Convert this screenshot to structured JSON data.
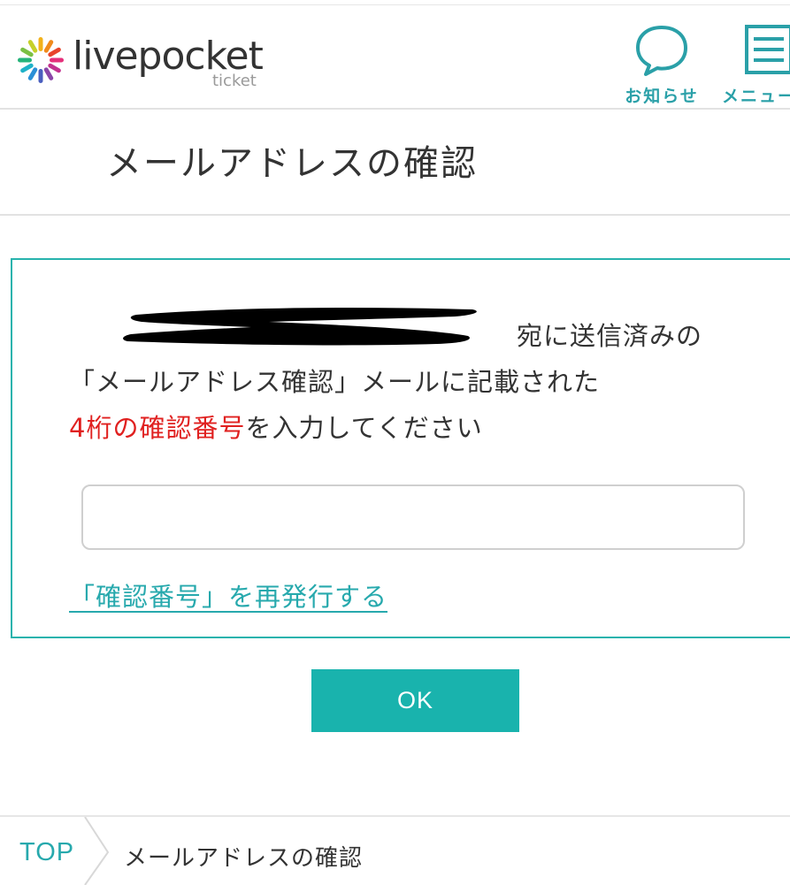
{
  "header": {
    "logo_text": "livepocket",
    "logo_sub": "ticket",
    "news_label": "お知らせ",
    "menu_label": "メニュー",
    "accent_color": "#2aa0a8"
  },
  "page": {
    "title": "メールアドレスの確認"
  },
  "form": {
    "instruction_line1": "宛に送信済みの",
    "instruction_line2": "「メールアドレス確認」メールに記載された",
    "instruction_highlight": "4桁の確認番号",
    "instruction_rest": "を入力してください",
    "code_value": "",
    "reissue_link": "「確認番号」を再発行する",
    "highlight_color": "#e0201f",
    "border_color": "#27b3ad"
  },
  "ok_button": {
    "label": "OK",
    "color": "#19b3ad"
  },
  "breadcrumb": {
    "top_label": "TOP",
    "current_label": "メールアドレスの確認"
  }
}
